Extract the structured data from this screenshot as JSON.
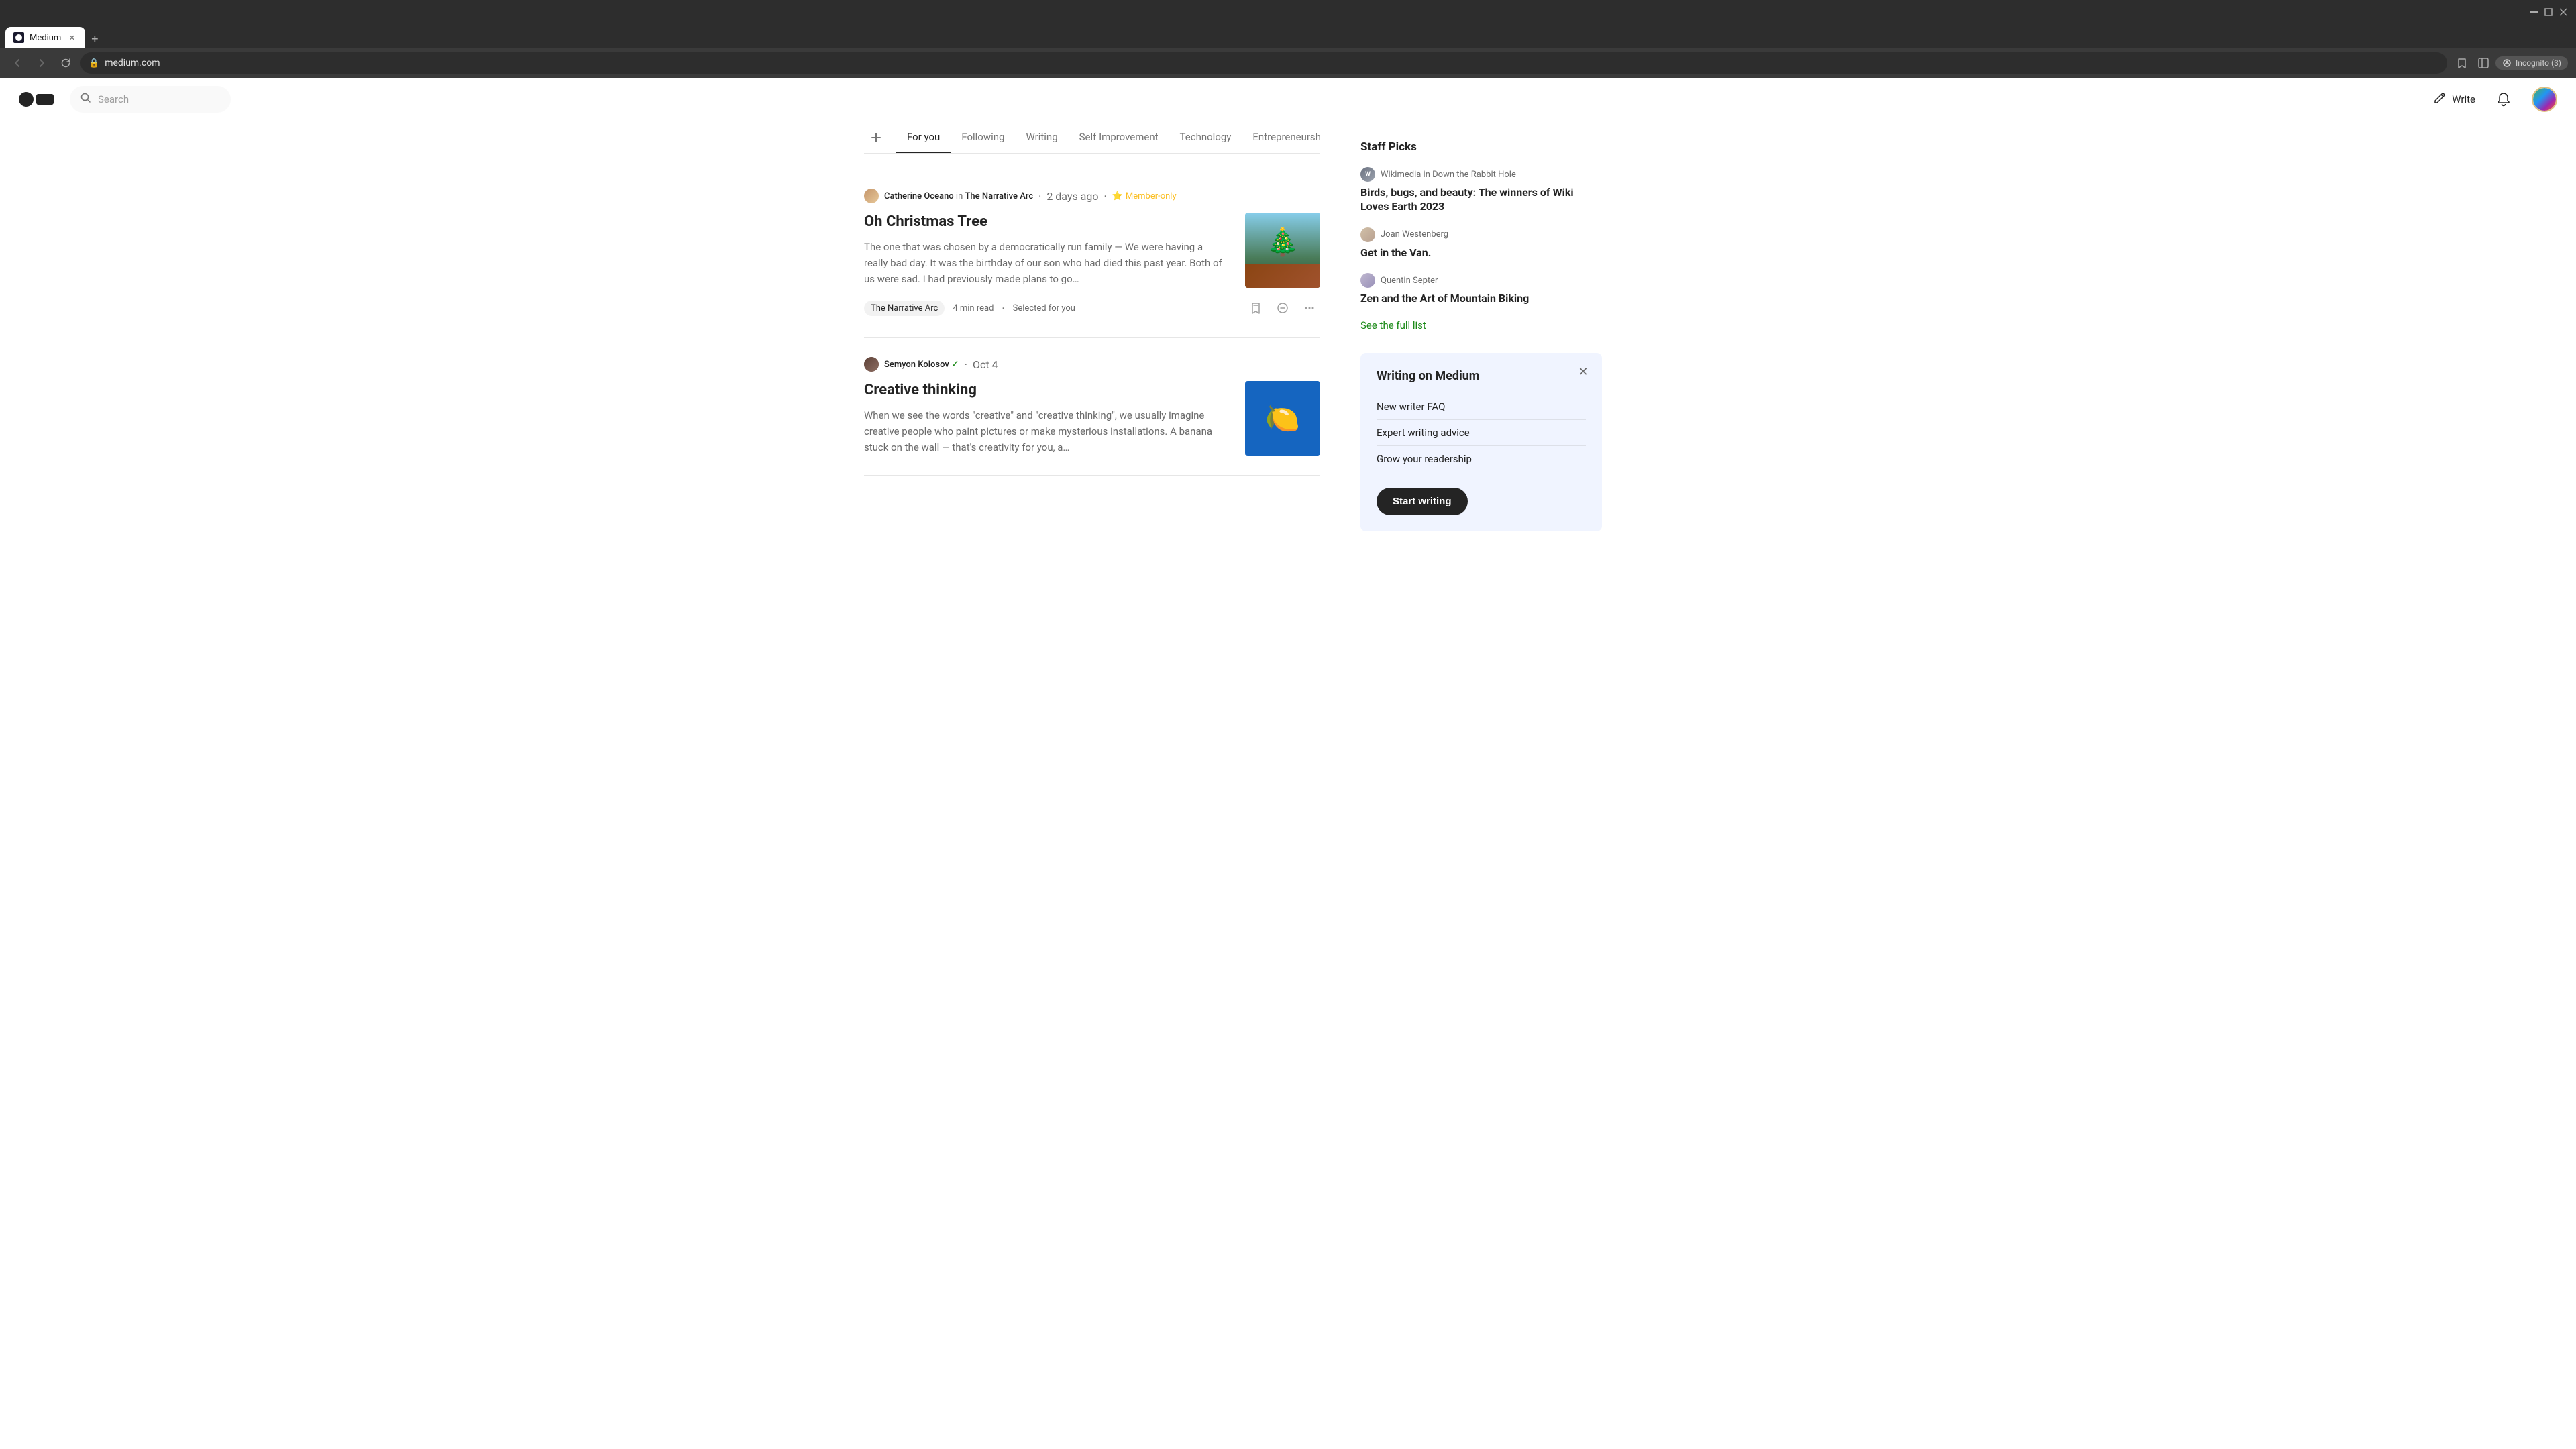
{
  "browser": {
    "tab_title": "Medium",
    "tab_icon": "medium-icon",
    "new_tab_label": "+",
    "address": "medium.com",
    "incognito_label": "Incognito (3)"
  },
  "header": {
    "logo_label": "Medium",
    "search_placeholder": "Search",
    "write_label": "Write",
    "nav": {
      "back_title": "Back",
      "forward_title": "Forward",
      "refresh_title": "Refresh"
    }
  },
  "tabs": {
    "add_label": "+",
    "items": [
      {
        "id": "for-you",
        "label": "For you",
        "active": true
      },
      {
        "id": "following",
        "label": "Following",
        "active": false
      },
      {
        "id": "writing",
        "label": "Writing",
        "active": false
      },
      {
        "id": "self-improvement",
        "label": "Self Improvement",
        "active": false
      },
      {
        "id": "technology",
        "label": "Technology",
        "active": false
      },
      {
        "id": "entrepreneurship",
        "label": "Entrepreneurship",
        "active": false
      }
    ]
  },
  "articles": [
    {
      "id": "article-1",
      "author": "Catherine Oceano",
      "in_text": "in",
      "publication": "The Narrative Arc",
      "time_ago": "2 days ago",
      "member_only": true,
      "member_icon": "⭐",
      "member_label": "Member-only",
      "title": "Oh Christmas Tree",
      "excerpt": "The one that was chosen by a democratically run family — We were having a really bad day. It was the birthday of our son who had died this past year. Both of us were sad. I had previously made plans to go…",
      "publication_tag": "The Narrative Arc",
      "read_time": "4 min read",
      "selected_label": "Selected for you",
      "thumb_type": "christmas"
    },
    {
      "id": "article-2",
      "author": "Semyon Kolosov",
      "verified": true,
      "time_ago": "Oct 4",
      "title": "Creative thinking",
      "excerpt": "When we see the words \"creative\" and \"creative thinking\", we usually imagine creative people who paint pictures or make mysterious installations. A banana stuck on the wall — that's creativity for you, a…",
      "thumb_type": "creative"
    }
  ],
  "sidebar": {
    "staff_picks_title": "Staff Picks",
    "picks": [
      {
        "id": "pick-1",
        "author": "Wikimedia",
        "in_text": "in",
        "publication": "Down the Rabbit Hole",
        "title": "Birds, bugs, and beauty: The winners of Wiki Loves Earth 2023",
        "avatar_type": "wiki"
      },
      {
        "id": "pick-2",
        "author": "Joan Westenberg",
        "title": "Get in the Van.",
        "avatar_type": "joan"
      },
      {
        "id": "pick-3",
        "author": "Quentin Septer",
        "title": "Zen and the Art of Mountain Biking",
        "avatar_type": "quentin"
      }
    ],
    "see_full_list_label": "See the full list",
    "writing_card": {
      "title": "Writing on Medium",
      "links": [
        {
          "label": "New writer FAQ"
        },
        {
          "label": "Expert writing advice"
        },
        {
          "label": "Grow your readership"
        }
      ],
      "start_writing_label": "Start writing"
    }
  }
}
